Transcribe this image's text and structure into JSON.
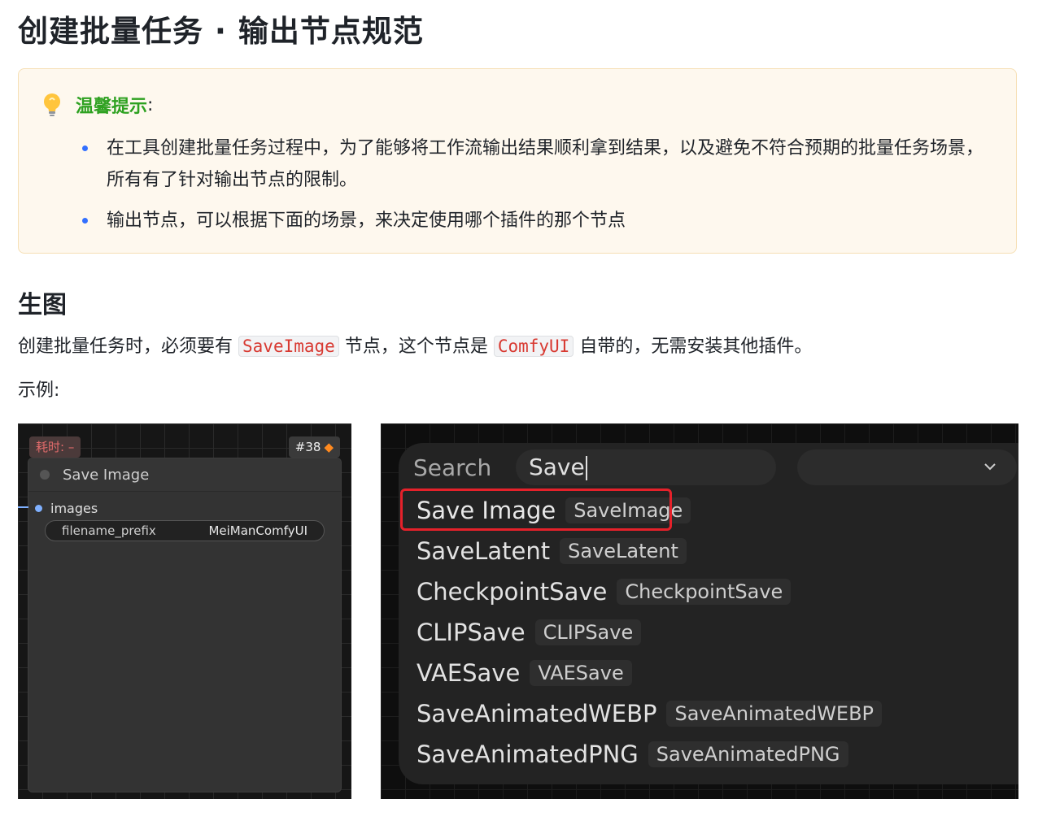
{
  "page": {
    "title": "创建批量任务 · 输出节点规范"
  },
  "callout": {
    "title": "温馨提示",
    "colon": ":",
    "items": [
      "在工具创建批量任务过程中，为了能够将工作流输出结果顺利拿到结果，以及避免不符合预期的批量任务场景，所有有了针对输出节点的限制。",
      "输出节点，可以根据下面的场景，来决定使用哪个插件的那个节点"
    ],
    "icon": "lightbulb-icon",
    "accent_color": "#2ea121",
    "bg_color": "#fef8ee"
  },
  "section": {
    "title": "生图",
    "para_part1": "创建批量任务时，必须要有",
    "code1": "SaveImage",
    "para_part2": "节点，这个节点是",
    "code2": "ComfyUI",
    "para_part3": "自带的，无需安装其他插件。",
    "example_label": "示例:"
  },
  "node_shot": {
    "time_badge": "耗时: –",
    "id_badge": "#38",
    "title": "Save Image",
    "input_label": "images",
    "widget_label": "filename_prefix",
    "widget_value": "MeiManComfyUI"
  },
  "search_shot": {
    "search_label": "Search",
    "search_value": "Save",
    "results": [
      {
        "name": "Save Image",
        "tag": "SaveImage",
        "selected": true
      },
      {
        "name": "SaveLatent",
        "tag": "SaveLatent"
      },
      {
        "name": "CheckpointSave",
        "tag": "CheckpointSave"
      },
      {
        "name": "CLIPSave",
        "tag": "CLIPSave"
      },
      {
        "name": "VAESave",
        "tag": "VAESave"
      },
      {
        "name": "SaveAnimatedWEBP",
        "tag": "SaveAnimatedWEBP"
      },
      {
        "name": "SaveAnimatedPNG",
        "tag": "SaveAnimatedPNG"
      }
    ],
    "highlight_color": "#e5212a"
  }
}
